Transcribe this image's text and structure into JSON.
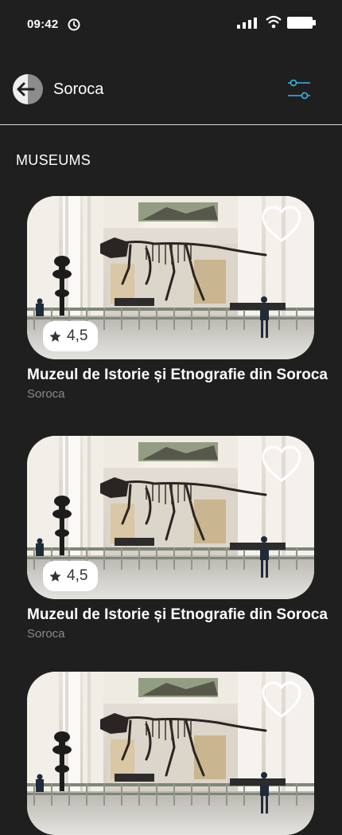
{
  "status_bar": {
    "time": "09:42"
  },
  "header": {
    "title": "Soroca"
  },
  "section": {
    "title": "MUSEUMS"
  },
  "cards": [
    {
      "title": "Muzeul de Istorie și Etnografie din Soroca",
      "location": "Soroca",
      "rating": "4,5"
    },
    {
      "title": "Muzeul de Istorie și Etnografie din Soroca",
      "location": "Soroca",
      "rating": "4,5"
    },
    {
      "title": "",
      "location": "",
      "rating": ""
    }
  ],
  "colors": {
    "background": "#1f1f1f",
    "accent": "#3ab6e8",
    "subtitle": "#8a8a8a"
  },
  "icons": [
    "clock-icon",
    "signal-icon",
    "wifi-icon",
    "battery-icon",
    "back-arrow-icon",
    "filter-sliders-icon",
    "heart-icon",
    "star-icon"
  ]
}
